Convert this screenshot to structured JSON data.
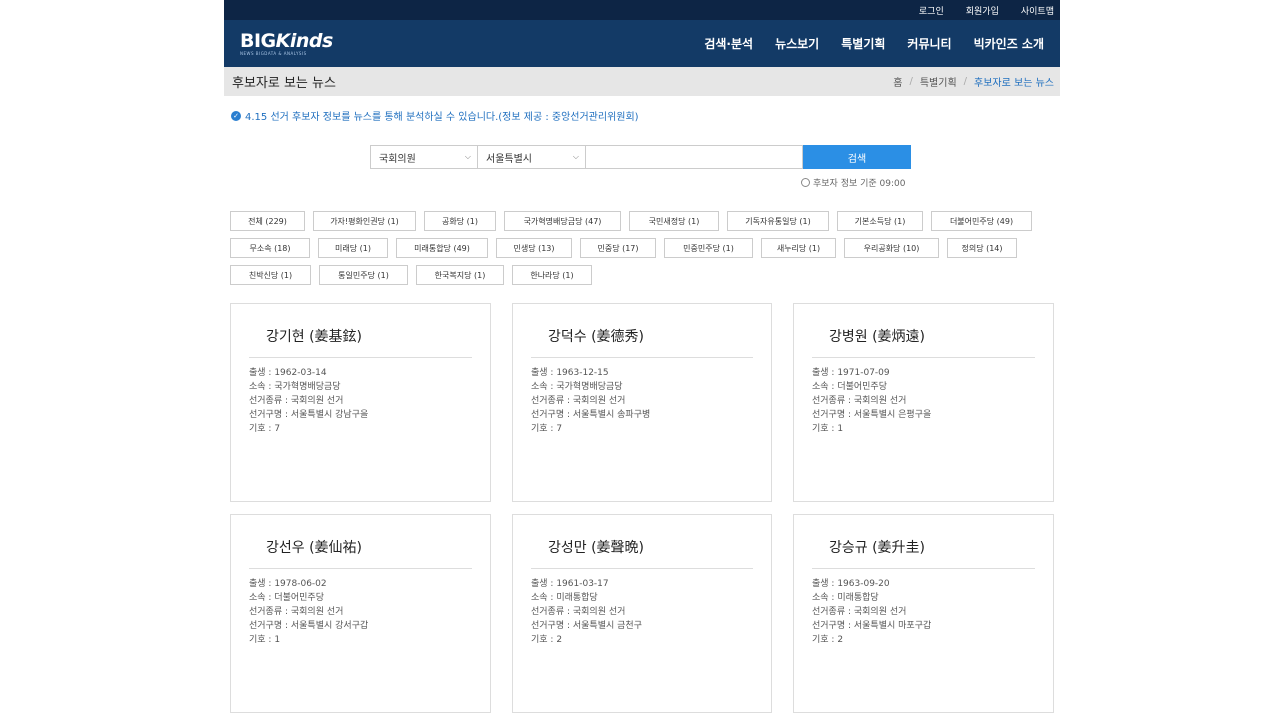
{
  "util": {
    "login": "로그인",
    "join": "회원가입",
    "sitemap": "사이트맵"
  },
  "logo": {
    "big_a": "BIG",
    "big_b": "Kinds",
    "sub": "NEWS BIGDATA & ANALYSIS"
  },
  "nav": [
    "검색·분석",
    "뉴스보기",
    "특별기획",
    "커뮤니티",
    "빅카인즈 소개"
  ],
  "page": {
    "title": "후보자로 보는 뉴스"
  },
  "breadcrumb": {
    "home": "홈",
    "level1": "특별기획",
    "current": "후보자로 보는 뉴스"
  },
  "notice": "4.15 선거 후보자 정보를 뉴스를 통해 분석하실 수 있습니다.(정보 제공 : 중앙선거관리위원회)",
  "search": {
    "type": "국회의원",
    "region": "서울특별시",
    "query": "",
    "button": "검색",
    "basis": "후보자 정보 기준 09:00"
  },
  "parties": [
    "전체 (229)",
    "가자!평화인권당 (1)",
    "공화당 (1)",
    "국가혁명배당금당 (47)",
    "국민새정당 (1)",
    "기독자유통일당 (1)",
    "기본소득당 (1)",
    "더불어민주당 (49)",
    "무소속 (18)",
    "미래당 (1)",
    "미래통합당 (49)",
    "민생당 (13)",
    "민중당 (17)",
    "민중민주당 (1)",
    "새누리당 (1)",
    "우리공화당 (10)",
    "정의당 (14)",
    "친박신당 (1)",
    "통일민주당 (1)",
    "한국복지당 (1)",
    "한나라당 (1)"
  ],
  "candidates": [
    {
      "name": "강기현 (姜基鉉)",
      "birth": "출생 : 1962-03-14",
      "party": "소속 : 국가혁명배당금당",
      "election": "선거종류 : 국회의원 선거",
      "district": "선거구명 : 서울특별시 강남구을",
      "number": "기호 : 7"
    },
    {
      "name": "강덕수 (姜德秀)",
      "birth": "출생 : 1963-12-15",
      "party": "소속 : 국가혁명배당금당",
      "election": "선거종류 : 국회의원 선거",
      "district": "선거구명 : 서울특별시 송파구병",
      "number": "기호 : 7"
    },
    {
      "name": "강병원 (姜炳遠)",
      "birth": "출생 : 1971-07-09",
      "party": "소속 : 더불어민주당",
      "election": "선거종류 : 국회의원 선거",
      "district": "선거구명 : 서울특별시 은평구을",
      "number": "기호 : 1"
    },
    {
      "name": "강선우 (姜仙祐)",
      "birth": "출생 : 1978-06-02",
      "party": "소속 : 더불어민주당",
      "election": "선거종류 : 국회의원 선거",
      "district": "선거구명 : 서울특별시 강서구갑",
      "number": "기호 : 1"
    },
    {
      "name": "강성만 (姜聲晩)",
      "birth": "출생 : 1961-03-17",
      "party": "소속 : 미래통합당",
      "election": "선거종류 : 국회의원 선거",
      "district": "선거구명 : 서울특별시 금천구",
      "number": "기호 : 2"
    },
    {
      "name": "강승규 (姜升圭)",
      "birth": "출생 : 1963-09-20",
      "party": "소속 : 미래통합당",
      "election": "선거종류 : 국회의원 선거",
      "district": "선거구명 : 서울특별시 마포구갑",
      "number": "기호 : 2"
    }
  ]
}
